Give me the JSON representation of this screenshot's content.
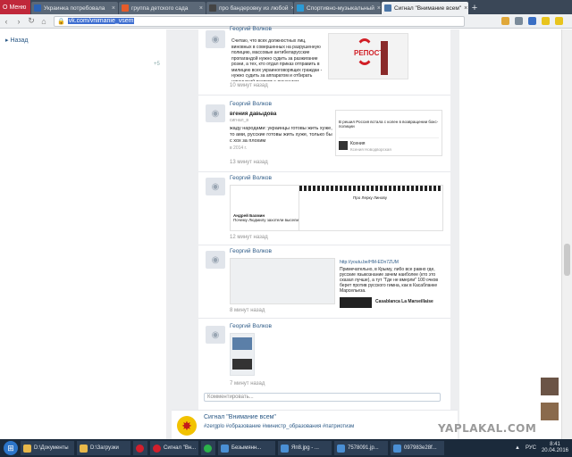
{
  "browser": {
    "menu_label": "Меню",
    "tabs": [
      {
        "label": "Украинка потребовала",
        "color": "#2a62b5"
      },
      {
        "label": "группа детского сада",
        "color": "#e65c2a"
      },
      {
        "label": "про бандеровку из любой",
        "color": "#444"
      },
      {
        "label": "Спортивно-музыкальный",
        "color": "#2a9ad6"
      },
      {
        "label": "Сигнал \"Внимание всем\"",
        "color": "#4a76a8"
      }
    ],
    "new_tab": "+",
    "url_prefix": "🔒",
    "url": "vk.com/vnimanie_vsem"
  },
  "left": {
    "item": "▸ Назад",
    "counter": "+5"
  },
  "posts": [
    {
      "author": "Георгий Волков",
      "text": "Считаю, что всех должностных лиц, виновных в совершенных на разрушенную полицию, массовые антибеларусские пропагандой нужно судить за разжигание розни, а тех, кто отдал приказ отправить в милицию всех украиноговорящих граждан - нужно судить за аппаратом и отбирать украинский паспорт с лишением гражданства. То же - за осквернение национального флага, тоже",
      "repost_label": "РЕПОСТ!",
      "time": "10 минут назад"
    },
    {
      "author": "Георгий Волков",
      "sub_author": "вгения давыдова",
      "sub_meta": "сигнал_в",
      "text": "жаду народами: украинцы готовы жить хуже, то ами, русские готовы жить хуже, только бы с хох за плохим",
      "sub_time": "в 2014 г.",
      "embed_text": "В решил Россия встала с колен в возвращении бокс-полиции",
      "embed_user": "Ксения",
      "embed_meta": "Ксения Новодворская",
      "time": "13 минут назад"
    },
    {
      "author": "Георгий Волков",
      "left_caption": "Андрей Бахмин",
      "left_text": "Почему Людмилу захотели выселить?",
      "right_caption": "Про Лерку Линову",
      "time": "12 минут назад"
    },
    {
      "author": "Георгий Волков",
      "right_text": "Примечательно, в Крыму, либо все равно где, русские языкознание зачем наиболее (кто это сказал лучше), а тут \"Где не вмерли\" 100 очков берет против русского гимна, как в Касабланке Марсельеза.",
      "link": "http://youtu.be/HM-EDn7ZUM",
      "music": "Casablanca La Marseillaise",
      "time": "8 минут назад"
    },
    {
      "author": "Георгий Волков",
      "time": "7 минут назад"
    }
  ],
  "comment_placeholder": "Комментировать...",
  "group": {
    "name": "Сигнал \"Внимание всем\"",
    "tags": "#zergplo #образование #министр_образования #патриотизм"
  },
  "watermark": "YAPLAKAL.COM",
  "taskbar": {
    "items": [
      {
        "label": "D:\\Документы",
        "color": "#e8b84a"
      },
      {
        "label": "D:\\Загрузки",
        "color": "#e8b84a"
      },
      {
        "label": "",
        "color": "#d31f2c"
      },
      {
        "label": "Сигнал \"Вн...",
        "color": "#d31f2c"
      },
      {
        "label": "",
        "color": "#2bb34a"
      },
      {
        "label": "Безымянн...",
        "color": "#4a8fd4"
      },
      {
        "label": "Яп8.jpg - ...",
        "color": "#4a8fd4"
      },
      {
        "label": "7578091.jp...",
        "color": "#4a8fd4"
      },
      {
        "label": "097983e28f...",
        "color": "#4a8fd4"
      }
    ],
    "lang": "РУС",
    "time": "8:41",
    "date": "20.04.2016"
  }
}
